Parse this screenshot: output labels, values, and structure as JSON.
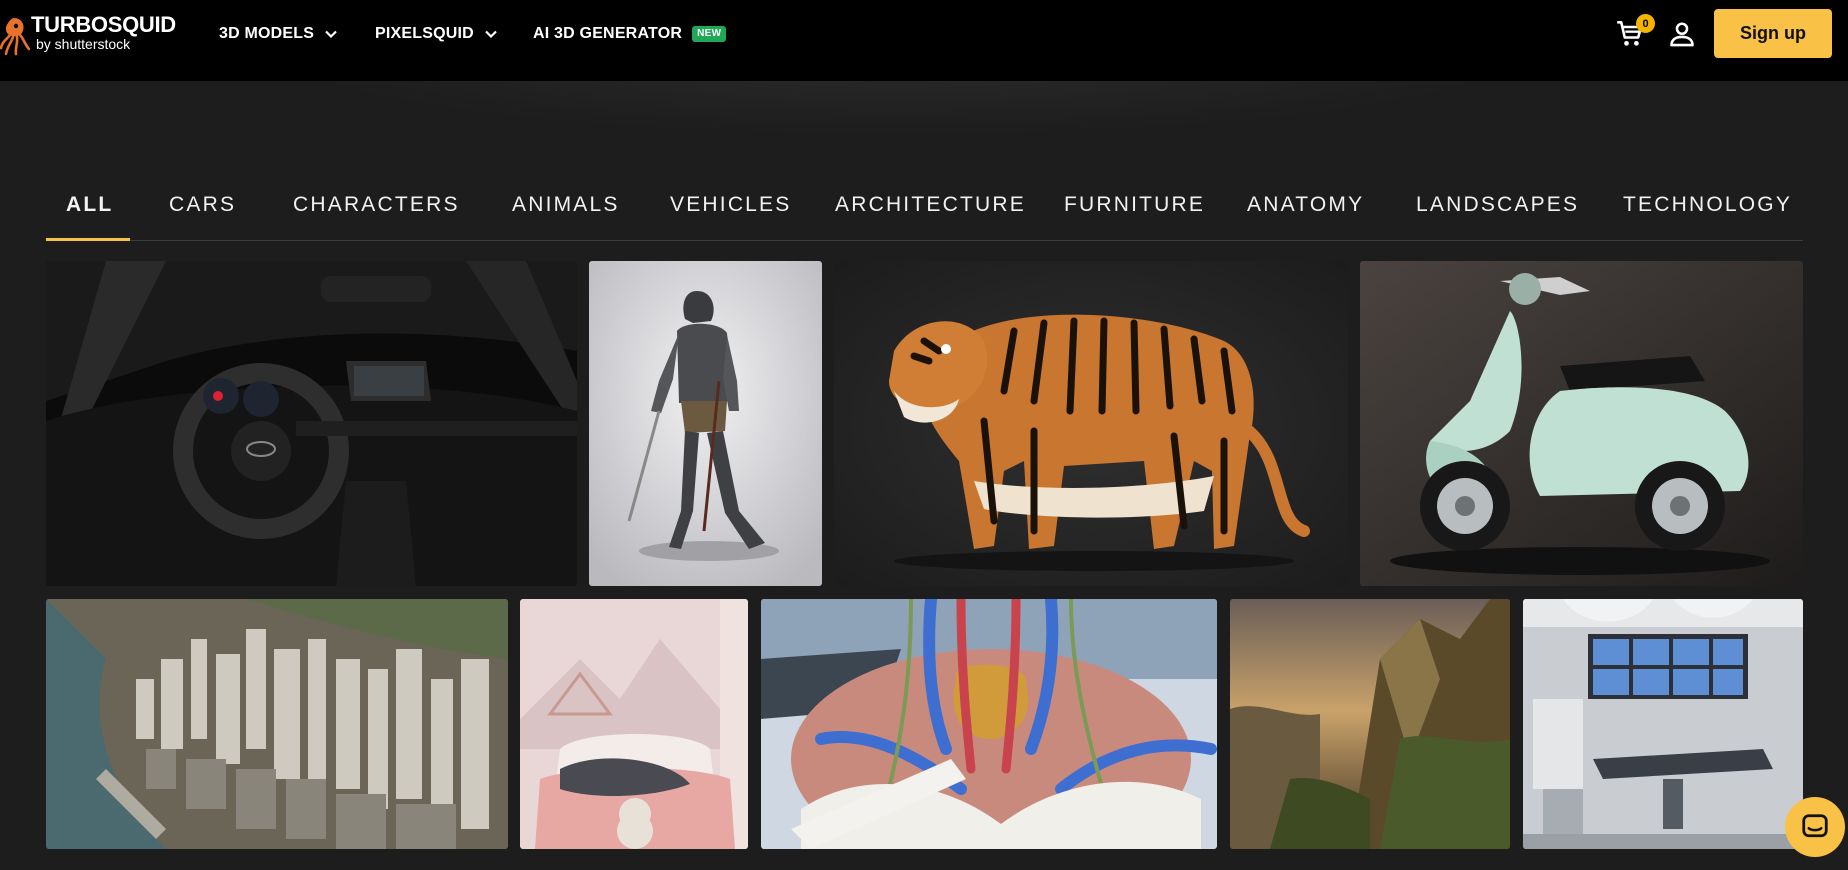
{
  "brand": {
    "name": "TURBOSQUID",
    "byline": "by shutterstock"
  },
  "nav": {
    "models": "3D MODELS",
    "pixelsquid": "PIXELSQUID",
    "ai_generator": "AI 3D GENERATOR",
    "new_badge": "NEW"
  },
  "header": {
    "cart_count": "0",
    "signup_label": "Sign up"
  },
  "categories": [
    "ALL",
    "CARS",
    "CHARACTERS",
    "ANIMALS",
    "VEHICLES",
    "ARCHITECTURE",
    "FURNITURE",
    "ANATOMY",
    "LANDSCAPES",
    "TECHNOLOGY"
  ],
  "active_category": "ALL",
  "gallery": [
    {
      "subject": "car-interior"
    },
    {
      "subject": "knight-armor"
    },
    {
      "subject": "tiger"
    },
    {
      "subject": "scooter"
    },
    {
      "subject": "city"
    },
    {
      "subject": "bedroom"
    },
    {
      "subject": "anatomy"
    },
    {
      "subject": "landscape"
    },
    {
      "subject": "operating-room"
    }
  ],
  "colors": {
    "accent": "#f9c146",
    "header_bg": "#000000",
    "page_bg": "#1d1d1d",
    "new_badge": "#1fa855"
  },
  "icons": [
    "squid-logo-icon",
    "chevron-down-icon",
    "cart-icon",
    "user-icon",
    "chat-icon"
  ]
}
